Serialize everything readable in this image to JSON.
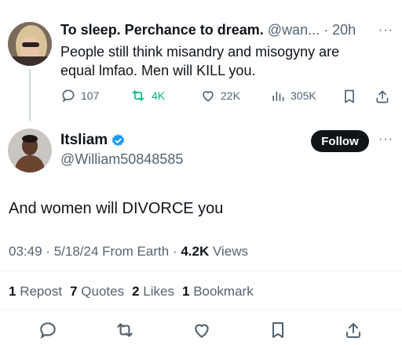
{
  "parent": {
    "display_name": "To sleep. Perchance to dream.",
    "handle": "@wan...",
    "separator": "·",
    "time": "20h",
    "more": "···",
    "text": "People still think misandry and misogyny are equal lmfao. Men will KILL you.",
    "actions": {
      "replies": "107",
      "reposts": "4K",
      "likes": "22K",
      "views": "305K"
    }
  },
  "tweet": {
    "display_name": "Itsliam",
    "handle": "@William50848585",
    "follow_label": "Follow",
    "more": "···",
    "text": "And women will DIVORCE you",
    "time": "03:49",
    "sep1": "·",
    "date": "5/18/24",
    "source": "From Earth",
    "sep2": "·",
    "views_count": "4.2K",
    "views_label": "Views"
  },
  "stats": {
    "reposts_count": "1",
    "reposts_label": "Repost",
    "quotes_count": "7",
    "quotes_label": "Quotes",
    "likes_count": "2",
    "likes_label": "Likes",
    "bookmarks_count": "1",
    "bookmarks_label": "Bookmark"
  },
  "colors": {
    "text": "#0f1419",
    "muted": "#536471",
    "verified": "#1d9bf0",
    "repost_active": "#00ba7c",
    "divider": "#eff3f4"
  },
  "icons": [
    "reply-icon",
    "repost-icon",
    "like-icon",
    "views-icon",
    "bookmark-icon",
    "share-icon",
    "verified-badge-icon",
    "more-icon"
  ]
}
